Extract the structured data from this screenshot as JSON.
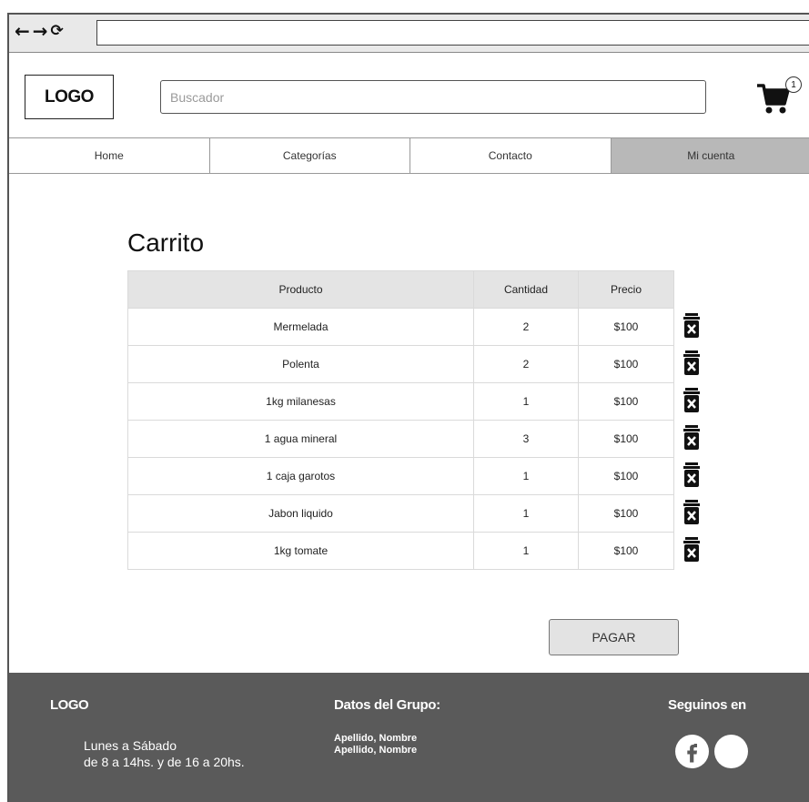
{
  "browser": {
    "back_icon": "arrow-left",
    "forward_icon": "arrow-right",
    "reload_icon": "reload",
    "url": ""
  },
  "header": {
    "logo": "LOGO",
    "search_placeholder": "Buscador",
    "cart_count": "1"
  },
  "nav": {
    "items": [
      {
        "label": "Home"
      },
      {
        "label": "Categorías"
      },
      {
        "label": "Contacto"
      },
      {
        "label": "Mi cuenta"
      }
    ]
  },
  "cart": {
    "title": "Carrito",
    "columns": [
      "Producto",
      "Cantidad",
      "Precio"
    ],
    "rows": [
      {
        "product": "Mermelada",
        "qty": "2",
        "price": "$100"
      },
      {
        "product": "Polenta",
        "qty": "2",
        "price": "$100"
      },
      {
        "product": "1kg milanesas",
        "qty": "1",
        "price": "$100"
      },
      {
        "product": "1 agua mineral",
        "qty": "3",
        "price": "$100"
      },
      {
        "product": "1 caja garotos",
        "qty": "1",
        "price": "$100"
      },
      {
        "product": "Jabon liquido",
        "qty": "1",
        "price": "$100"
      },
      {
        "product": "1kg tomate",
        "qty": "1",
        "price": "$100"
      }
    ],
    "pay_label": "PAGAR"
  },
  "footer": {
    "logo": "LOGO",
    "hours_line1": "Lunes a Sábado",
    "hours_line2": "de 8 a 14hs. y de 16 a 20hs.",
    "group_title": "Datos del Grupo:",
    "member1": "Apellido, Nombre",
    "member2": "Apellido, Nombre",
    "follow_title": "Seguinos en",
    "social_icons": [
      "facebook-icon",
      "social-circle-icon"
    ]
  },
  "colors": {
    "footer_bg": "#5a5a5a",
    "table_header_bg": "#e4e4e4",
    "active_nav_bg": "#b8b8b8"
  }
}
